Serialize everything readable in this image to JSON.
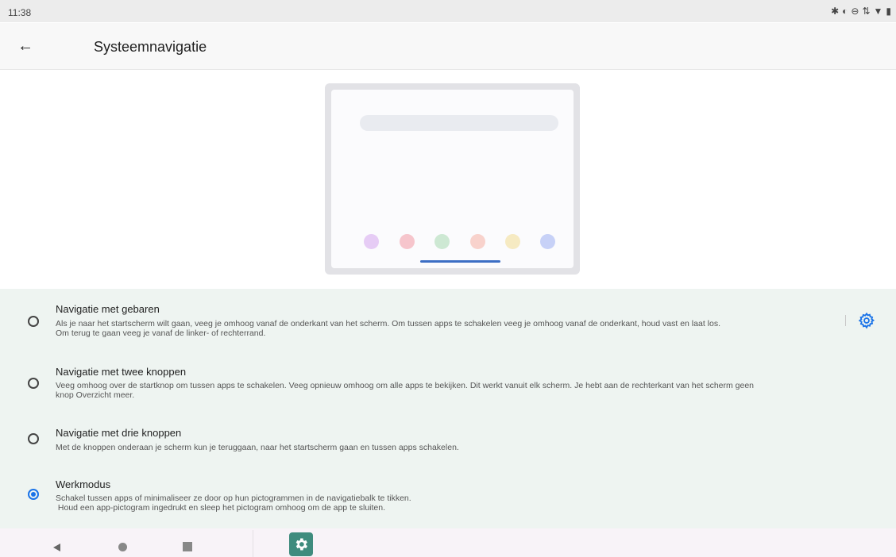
{
  "status_bar": {
    "time": "11:38",
    "icons": [
      "bluetooth-icon",
      "vibrate-icon",
      "dnd-icon",
      "data-icon",
      "wifi-icon",
      "battery-icon"
    ]
  },
  "app_bar": {
    "back_icon": "←",
    "title": "Systeemnavigatie"
  },
  "illustration": {
    "dot_colors": [
      "#e6ccf5",
      "#f6c5cc",
      "#cde8d3",
      "#f8d2cc",
      "#f6eac2",
      "#c7d1f7"
    ],
    "handle_color": "#3c6ec4"
  },
  "options": [
    {
      "title": "Navigatie met gebaren",
      "description_lines": [
        "Als je naar het startscherm wilt gaan, veeg je omhoog vanaf de onderkant van het scherm. Om tussen apps te schakelen veeg je omhoog vanaf de onderkant, houd vast en laat los.",
        "Om terug te gaan veeg je vanaf de linker- of rechterrand."
      ],
      "selected": false,
      "has_settings": true
    },
    {
      "title": "Navigatie met twee knoppen",
      "description_lines": [
        "Veeg omhoog over de startknop om tussen apps te schakelen. Veeg opnieuw omhoog om alle apps te bekijken. Dit werkt vanuit elk scherm. Je hebt aan de rechterkant van het scherm geen",
        "knop Overzicht meer."
      ],
      "selected": false,
      "has_settings": false
    },
    {
      "title": "Navigatie met drie knoppen",
      "description_lines": [
        "Met de knoppen onderaan je scherm kun je teruggaan, naar het startscherm gaan en tussen apps schakelen."
      ],
      "selected": false,
      "has_settings": false
    },
    {
      "title": "Werkmodus",
      "description_lines": [
        "Schakel tussen apps of minimaliseer ze door op hun pictogrammen in de navigatiebalk te tikken.",
        " Houd een app-pictogram ingedrukt en sleep het pictogram omhoog om de app te sluiten."
      ],
      "selected": true,
      "has_settings": false
    }
  ],
  "colors": {
    "accent": "#1a73e8",
    "options_background": "#eef4f1",
    "settings_app_icon": "#3f8c7e"
  },
  "nav_bar": {
    "buttons": [
      "back-icon",
      "home-icon",
      "recents-icon"
    ],
    "taskbar_app": "settings-app-icon"
  }
}
